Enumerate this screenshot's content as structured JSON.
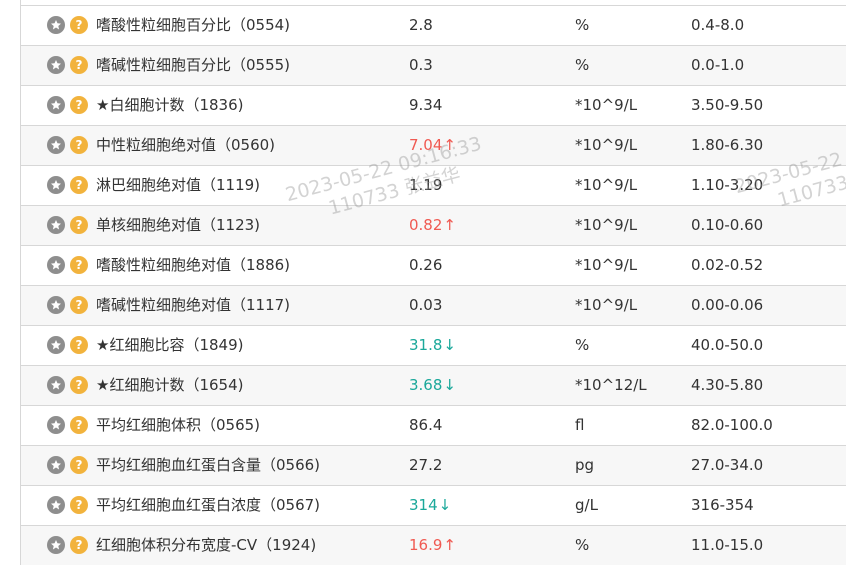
{
  "table": {
    "rows": [
      {
        "name": "嗜酸性粒细胞百分比（0554)",
        "result": "2.8",
        "flag": "",
        "unit": "%",
        "range": "0.4-8.0"
      },
      {
        "name": "嗜碱性粒细胞百分比（0555)",
        "result": "0.3",
        "flag": "",
        "unit": "%",
        "range": "0.0-1.0"
      },
      {
        "name": "★白细胞计数（1836)",
        "result": "9.34",
        "flag": "",
        "unit": "*10^9/L",
        "range": "3.50-9.50"
      },
      {
        "name": "中性粒细胞绝对值（0560)",
        "result": "7.04",
        "flag": "up",
        "unit": "*10^9/L",
        "range": "1.80-6.30"
      },
      {
        "name": "淋巴细胞绝对值（1119)",
        "result": "1.19",
        "flag": "",
        "unit": "*10^9/L",
        "range": "1.10-3.20"
      },
      {
        "name": "单核细胞绝对值（1123)",
        "result": "0.82",
        "flag": "up",
        "unit": "*10^9/L",
        "range": "0.10-0.60"
      },
      {
        "name": "嗜酸性粒细胞绝对值（1886)",
        "result": "0.26",
        "flag": "",
        "unit": "*10^9/L",
        "range": "0.02-0.52"
      },
      {
        "name": "嗜碱性粒细胞绝对值（1117)",
        "result": "0.03",
        "flag": "",
        "unit": "*10^9/L",
        "range": "0.00-0.06"
      },
      {
        "name": "★红细胞比容（1849)",
        "result": "31.8",
        "flag": "down",
        "unit": "%",
        "range": "40.0-50.0"
      },
      {
        "name": "★红细胞计数（1654)",
        "result": "3.68",
        "flag": "down",
        "unit": "*10^12/L",
        "range": "4.30-5.80"
      },
      {
        "name": "平均红细胞体积（0565)",
        "result": "86.4",
        "flag": "",
        "unit": "fl",
        "range": "82.0-100.0"
      },
      {
        "name": "平均红细胞血红蛋白含量（0566)",
        "result": "27.2",
        "flag": "",
        "unit": "pg",
        "range": "27.0-34.0"
      },
      {
        "name": "平均红细胞血红蛋白浓度（0567)",
        "result": "314",
        "flag": "down",
        "unit": "g/L",
        "range": "316-354"
      },
      {
        "name": "红细胞体积分布宽度-CV（1924)",
        "result": "16.9",
        "flag": "up",
        "unit": "%",
        "range": "11.0-15.0"
      }
    ],
    "icons": {
      "star": "star-icon",
      "help": "question-icon"
    },
    "help_glyph": "?",
    "arrows": {
      "up": "↑",
      "down": "↓"
    }
  },
  "watermark": {
    "timestamp": "2023-05-22 09:16:33",
    "user": "110733 张益华",
    "timestamp_partial": "2023-05-22",
    "user_partial": "110733 元"
  },
  "colors": {
    "high": "#f05a52",
    "low": "#1aa89a",
    "star_icon_bg": "#8e8e8e",
    "help_icon_bg": "#f2b33d",
    "border": "#d7d7d7",
    "alt_row": "#f7f7f7"
  }
}
